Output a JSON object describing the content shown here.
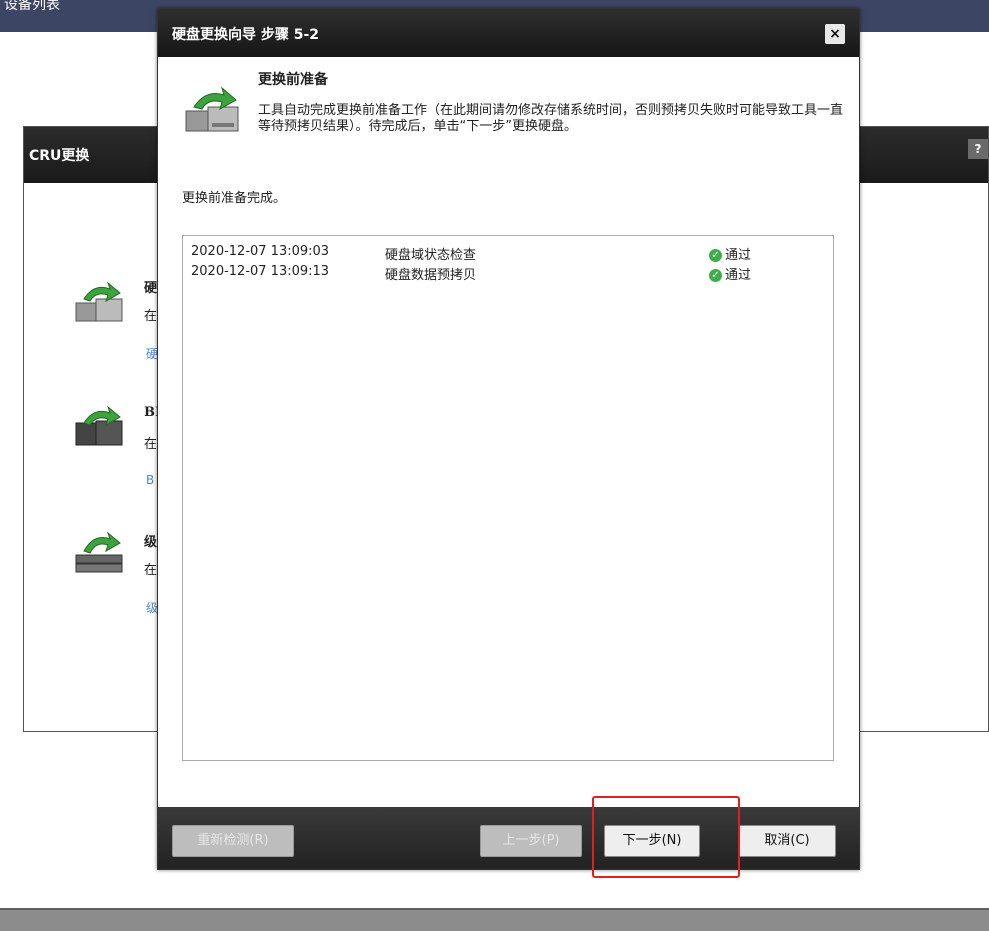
{
  "background": {
    "top_title": "设备列表",
    "cru_panel": {
      "title": "CRU更换",
      "help": "?",
      "items": [
        {
          "name": "硬",
          "desc": "在",
          "link": "硬"
        },
        {
          "name": "BI",
          "desc": "在",
          "link": "B"
        },
        {
          "name": "级",
          "desc": "在",
          "link": "级"
        }
      ]
    }
  },
  "dialog": {
    "title": "硬盘更换向导 步骤 5-2",
    "close": "×",
    "header": {
      "title": "更换前准备",
      "desc": "工具自动完成更换前准备工作（在此期间请勿修改存储系统时间，否则预拷贝失败时可能导致工具一直等待预拷贝结果）。待完成后，单击“下一步”更换硬盘。"
    },
    "status": "更换前准备完成。",
    "log": [
      {
        "time": "2020-12-07 13:09:03",
        "task": "硬盘域状态检查",
        "result": "通过"
      },
      {
        "time": "2020-12-07 13:09:13",
        "task": "硬盘数据预拷贝",
        "result": "通过"
      }
    ],
    "buttons": {
      "recheck": "重新检测(R)",
      "prev": "上一步(P)",
      "next": "下一步(N)",
      "cancel": "取消(C)"
    }
  },
  "colors": {
    "highlight": "#e0201b",
    "link": "#4f88c6",
    "ok": "#3fae49"
  }
}
